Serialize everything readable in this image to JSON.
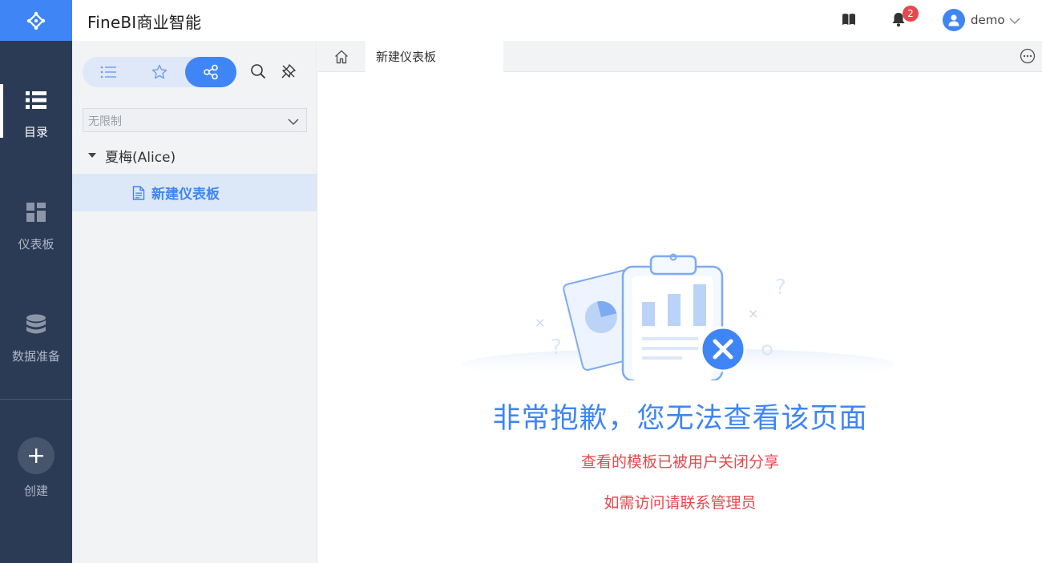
{
  "app": {
    "title": "FineBI商业智能"
  },
  "nav": {
    "items": [
      {
        "label": "目录",
        "icon": "list-icon",
        "active": true
      },
      {
        "label": "仪表板",
        "icon": "dashboard-icon",
        "active": false
      },
      {
        "label": "数据准备",
        "icon": "database-icon",
        "active": false
      }
    ],
    "create_label": "创建"
  },
  "header": {
    "notification_count": "2",
    "user_name": "demo"
  },
  "tree": {
    "filter_value": "无限制",
    "folder_label": "夏梅(Alice)",
    "leaf_label": "新建仪表板"
  },
  "tabs": {
    "items": [
      {
        "label": "新建仪表板"
      }
    ]
  },
  "error": {
    "title": "非常抱歉，您无法查看该页面",
    "line1": "查看的模板已被用户关闭分享",
    "line2": "如需访问请联系管理员"
  },
  "colors": {
    "accent": "#3f85f5",
    "nav_bg": "#2c3b55",
    "error_red": "#e5484d"
  }
}
